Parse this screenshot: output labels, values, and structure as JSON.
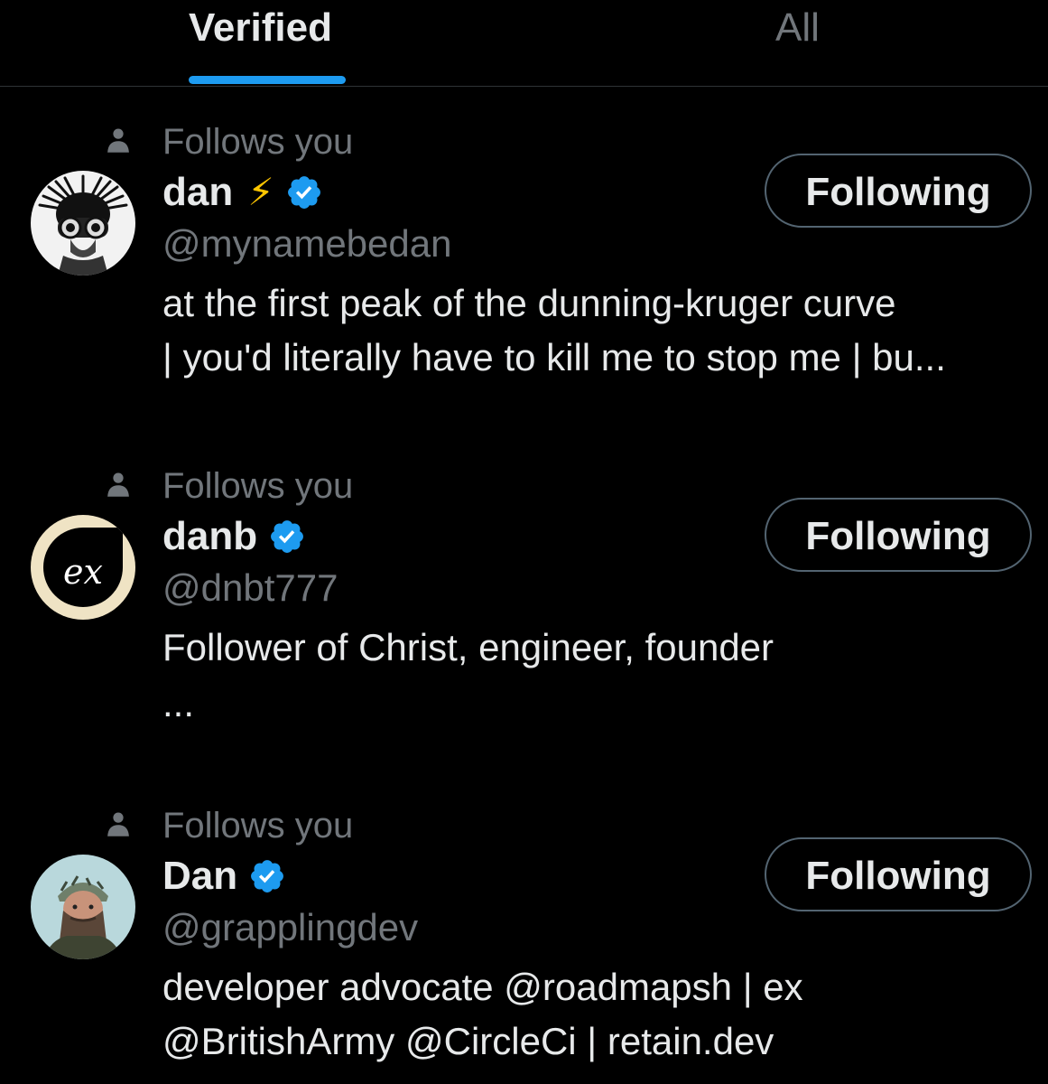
{
  "tabs": {
    "verified_label": "Verified",
    "all_label": "All",
    "active": "verified",
    "indicator_color": "#1d9bf0"
  },
  "colors": {
    "background": "#000000",
    "primary_text": "#e7e9ea",
    "secondary_text": "#71767b",
    "verified_badge": "#1d9bf0",
    "button_border": "#536471"
  },
  "users": [
    {
      "follows_label": "Follows you",
      "name": "dan",
      "emoji": "⚡",
      "verified": true,
      "handle": "@mynamebedan",
      "bio_lines": [
        "at the first peak of the dunning-kruger curve",
        "| you'd literally have to kill me to stop me | bu..."
      ],
      "button_label": "Following",
      "avatar_icon": "goggles-avatar-icon"
    },
    {
      "follows_label": "Follows you",
      "name": "danb",
      "verified": true,
      "handle": "@dnbt777",
      "bio_lines": [
        "Follower of Christ, engineer, founder"
      ],
      "bio_ellipsis": "...",
      "button_label": "Following",
      "avatar_icon": "ex-logo-avatar-icon",
      "avatar_text": "ex"
    },
    {
      "follows_label": "Follows you",
      "name": "Dan",
      "verified": true,
      "handle": "@grapplingdev",
      "bio_lines": [
        "developer advocate @roadmapsh | ex",
        "@BritishArmy @CircleCi | retain.dev"
      ],
      "button_label": "Following",
      "avatar_icon": "bearded-man-avatar-icon"
    }
  ]
}
